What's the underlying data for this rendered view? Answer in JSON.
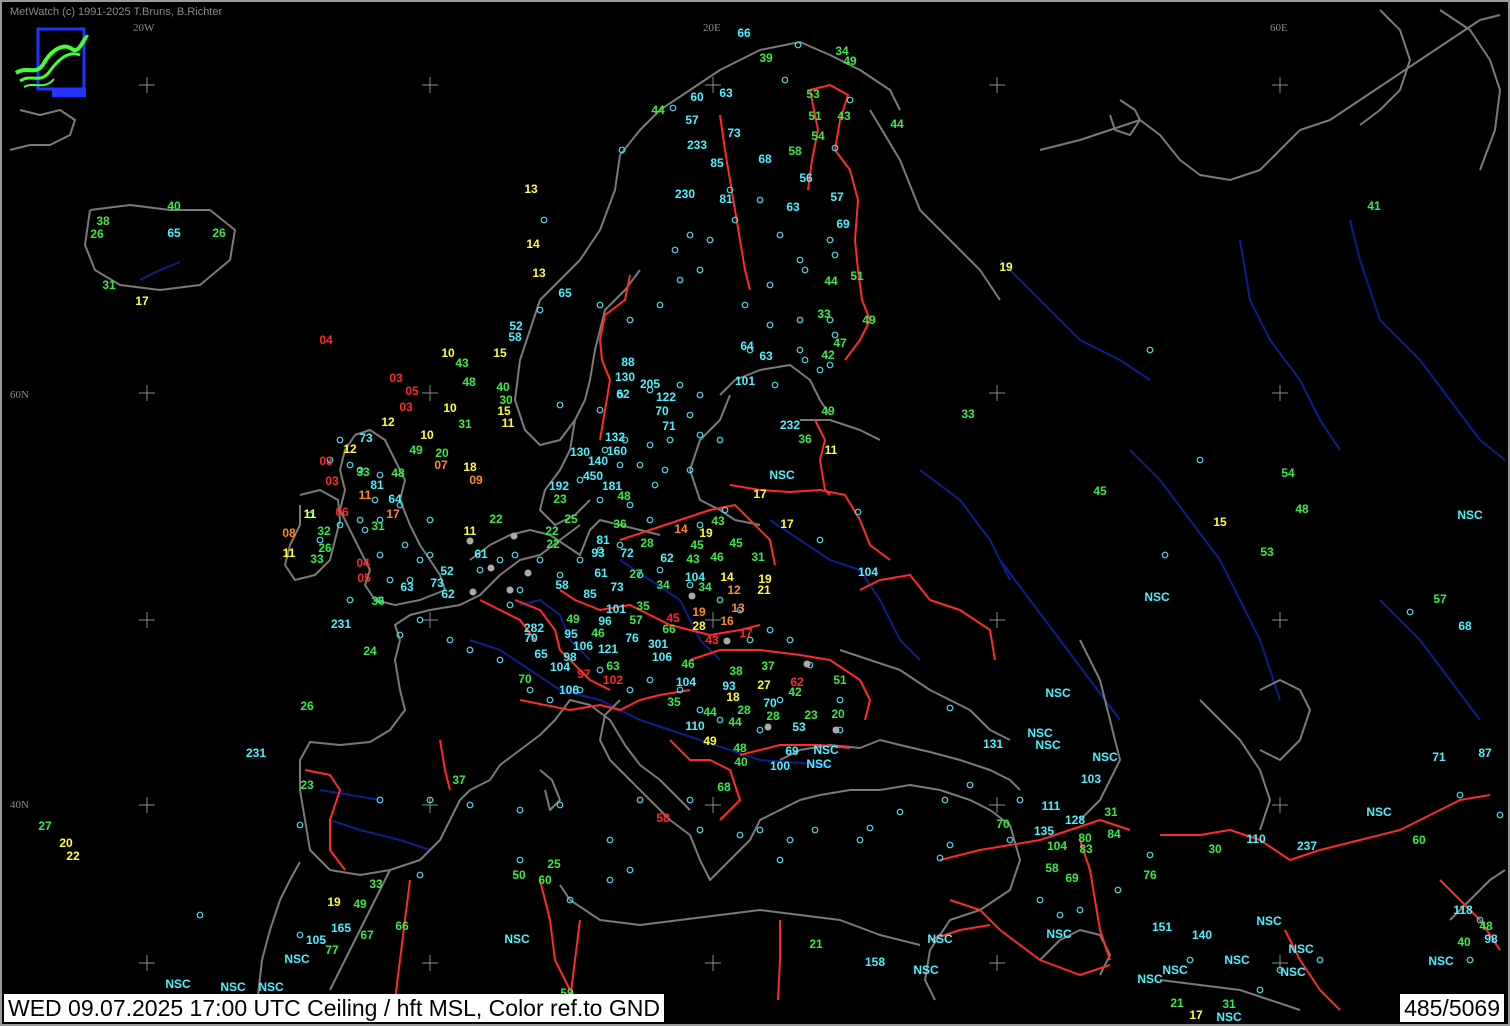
{
  "app": {
    "copyright": "MetWatch  (c) 1991-2025 T.Bruns, B.Richter",
    "status": "WED 09.07.2025 17:00 UTC    Ceiling / hft MSL, Color ref.to GND",
    "count": "485/5069"
  },
  "colors": {
    "background": "#000000",
    "coastline": "#7a7a7a",
    "borders": "#ff2a2a",
    "rivers": "#0d1f8c",
    "station": "#4ad8e8",
    "cyan": "#4ef2ff",
    "green": "#3ee84a",
    "yellow": "#ffff33",
    "orange": "#ff8a2a",
    "red": "#ff2a2a"
  },
  "grid_labels": [
    "20W",
    "20E",
    "60E",
    "60N",
    "40N"
  ],
  "observations": [
    {
      "text": "66",
      "c": "cyan"
    },
    {
      "text": "39",
      "c": "green"
    },
    {
      "text": "34",
      "c": "green"
    },
    {
      "text": "49",
      "c": "green"
    },
    {
      "text": "44",
      "c": "green"
    },
    {
      "text": "60",
      "c": "cyan"
    },
    {
      "text": "63",
      "c": "cyan"
    },
    {
      "text": "57",
      "c": "cyan"
    },
    {
      "text": "53",
      "c": "green"
    },
    {
      "text": "51",
      "c": "green"
    },
    {
      "text": "43",
      "c": "green"
    },
    {
      "text": "44",
      "c": "green"
    },
    {
      "text": "73",
      "c": "cyan"
    },
    {
      "text": "54",
      "c": "green"
    },
    {
      "text": "233",
      "c": "cyan"
    },
    {
      "text": "58",
      "c": "green"
    },
    {
      "text": "85",
      "c": "cyan"
    },
    {
      "text": "68",
      "c": "cyan"
    },
    {
      "text": "56",
      "c": "cyan"
    },
    {
      "text": "13",
      "c": "yellow"
    },
    {
      "text": "230",
      "c": "cyan"
    },
    {
      "text": "81",
      "c": "cyan"
    },
    {
      "text": "57",
      "c": "cyan"
    },
    {
      "text": "63",
      "c": "cyan"
    },
    {
      "text": "69",
      "c": "cyan"
    },
    {
      "text": "40",
      "c": "green"
    },
    {
      "text": "41",
      "c": "green"
    },
    {
      "text": "38",
      "c": "green"
    },
    {
      "text": "26",
      "c": "green"
    },
    {
      "text": "65",
      "c": "cyan"
    },
    {
      "text": "26",
      "c": "green"
    },
    {
      "text": "14",
      "c": "yellow"
    },
    {
      "text": "19",
      "c": "yellow"
    },
    {
      "text": "13",
      "c": "yellow"
    },
    {
      "text": "51",
      "c": "green"
    },
    {
      "text": "31",
      "c": "green"
    },
    {
      "text": "17",
      "c": "yellow"
    },
    {
      "text": "44",
      "c": "green"
    },
    {
      "text": "65",
      "c": "cyan"
    },
    {
      "text": "33",
      "c": "green"
    },
    {
      "text": "49",
      "c": "green"
    },
    {
      "text": "52",
      "c": "cyan"
    },
    {
      "text": "58",
      "c": "cyan"
    },
    {
      "text": "47",
      "c": "green"
    },
    {
      "text": "04",
      "c": "red"
    },
    {
      "text": "64",
      "c": "cyan"
    },
    {
      "text": "63",
      "c": "cyan"
    },
    {
      "text": "42",
      "c": "green"
    },
    {
      "text": "10",
      "c": "yellow"
    },
    {
      "text": "15",
      "c": "yellow"
    },
    {
      "text": "43",
      "c": "green"
    },
    {
      "text": "88",
      "c": "cyan"
    },
    {
      "text": "03",
      "c": "red"
    },
    {
      "text": "48",
      "c": "green"
    },
    {
      "text": "130",
      "c": "cyan"
    },
    {
      "text": "205",
      "c": "cyan"
    },
    {
      "text": "101",
      "c": "cyan"
    },
    {
      "text": "05",
      "c": "red"
    },
    {
      "text": "40",
      "c": "green"
    },
    {
      "text": "62",
      "c": "cyan"
    },
    {
      "text": "122",
      "c": "cyan"
    },
    {
      "text": "30",
      "c": "green"
    },
    {
      "text": "03",
      "c": "red"
    },
    {
      "text": "10",
      "c": "yellow"
    },
    {
      "text": "15",
      "c": "yellow"
    },
    {
      "text": "70",
      "c": "cyan"
    },
    {
      "text": "49",
      "c": "green"
    },
    {
      "text": "33",
      "c": "green"
    },
    {
      "text": "12",
      "c": "yellow"
    },
    {
      "text": "31",
      "c": "green"
    },
    {
      "text": "11",
      "c": "yellow"
    },
    {
      "text": "71",
      "c": "cyan"
    },
    {
      "text": "232",
      "c": "cyan"
    },
    {
      "text": "73",
      "c": "cyan"
    },
    {
      "text": "10",
      "c": "yellow"
    },
    {
      "text": "132",
      "c": "cyan"
    },
    {
      "text": "36",
      "c": "green"
    },
    {
      "text": "12",
      "c": "yellow"
    },
    {
      "text": "49",
      "c": "green"
    },
    {
      "text": "20",
      "c": "green"
    },
    {
      "text": "160",
      "c": "cyan"
    },
    {
      "text": "11",
      "c": "yellow"
    },
    {
      "text": "03",
      "c": "red"
    },
    {
      "text": "130",
      "c": "cyan"
    },
    {
      "text": "07",
      "c": "orange"
    },
    {
      "text": "140",
      "c": "cyan"
    },
    {
      "text": "18",
      "c": "yellow"
    },
    {
      "text": "33",
      "c": "green"
    },
    {
      "text": "48",
      "c": "green"
    },
    {
      "text": "450",
      "c": "cyan"
    },
    {
      "text": "NSC",
      "c": "cyan"
    },
    {
      "text": "03",
      "c": "red"
    },
    {
      "text": "09",
      "c": "orange"
    },
    {
      "text": "81",
      "c": "cyan"
    },
    {
      "text": "192",
      "c": "cyan"
    },
    {
      "text": "181",
      "c": "cyan"
    },
    {
      "text": "17",
      "c": "yellow"
    },
    {
      "text": "11",
      "c": "orange"
    },
    {
      "text": "64",
      "c": "cyan"
    },
    {
      "text": "23",
      "c": "green"
    },
    {
      "text": "48",
      "c": "green"
    },
    {
      "text": "54",
      "c": "green"
    },
    {
      "text": "45",
      "c": "green"
    },
    {
      "text": "11",
      "c": "yellow"
    },
    {
      "text": "06",
      "c": "red"
    },
    {
      "text": "17",
      "c": "orange"
    },
    {
      "text": "25",
      "c": "green"
    },
    {
      "text": "48",
      "c": "green"
    },
    {
      "text": "22",
      "c": "green"
    },
    {
      "text": "17",
      "c": "yellow"
    },
    {
      "text": "08",
      "c": "orange"
    },
    {
      "text": "31",
      "c": "green"
    },
    {
      "text": "11",
      "c": "yellow"
    },
    {
      "text": "36",
      "c": "green"
    },
    {
      "text": "15",
      "c": "yellow"
    },
    {
      "text": "43",
      "c": "green"
    },
    {
      "text": "32",
      "c": "green"
    },
    {
      "text": "22",
      "c": "green"
    },
    {
      "text": "14",
      "c": "orange"
    },
    {
      "text": "19",
      "c": "yellow"
    },
    {
      "text": "NSC",
      "c": "cyan"
    },
    {
      "text": "26",
      "c": "green"
    },
    {
      "text": "81",
      "c": "cyan"
    },
    {
      "text": "28",
      "c": "green"
    },
    {
      "text": "45",
      "c": "green"
    },
    {
      "text": "45",
      "c": "green"
    },
    {
      "text": "11",
      "c": "yellow"
    },
    {
      "text": "22",
      "c": "green"
    },
    {
      "text": "53",
      "c": "green"
    },
    {
      "text": "33",
      "c": "green"
    },
    {
      "text": "61",
      "c": "cyan"
    },
    {
      "text": "93",
      "c": "cyan"
    },
    {
      "text": "72",
      "c": "cyan"
    },
    {
      "text": "62",
      "c": "cyan"
    },
    {
      "text": "43",
      "c": "green"
    },
    {
      "text": "46",
      "c": "green"
    },
    {
      "text": "31",
      "c": "green"
    },
    {
      "text": "04",
      "c": "red"
    },
    {
      "text": "52",
      "c": "cyan"
    },
    {
      "text": "27",
      "c": "green"
    },
    {
      "text": "104",
      "c": "cyan"
    },
    {
      "text": "05",
      "c": "red"
    },
    {
      "text": "73",
      "c": "cyan"
    },
    {
      "text": "61",
      "c": "cyan"
    },
    {
      "text": "104",
      "c": "cyan"
    },
    {
      "text": "14",
      "c": "yellow"
    },
    {
      "text": "19",
      "c": "yellow"
    },
    {
      "text": "63",
      "c": "cyan"
    },
    {
      "text": "58",
      "c": "cyan"
    },
    {
      "text": "34",
      "c": "green"
    },
    {
      "text": "34",
      "c": "green"
    },
    {
      "text": "12",
      "c": "orange"
    },
    {
      "text": "21",
      "c": "yellow"
    },
    {
      "text": "62",
      "c": "cyan"
    },
    {
      "text": "85",
      "c": "cyan"
    },
    {
      "text": "73",
      "c": "cyan"
    },
    {
      "text": "NSC",
      "c": "cyan"
    },
    {
      "text": "57",
      "c": "green"
    },
    {
      "text": "36",
      "c": "green"
    },
    {
      "text": "101",
      "c": "cyan"
    },
    {
      "text": "35",
      "c": "green"
    },
    {
      "text": "19",
      "c": "orange"
    },
    {
      "text": "13",
      "c": "orange"
    },
    {
      "text": "231",
      "c": "cyan"
    },
    {
      "text": "49",
      "c": "green"
    },
    {
      "text": "96",
      "c": "cyan"
    },
    {
      "text": "57",
      "c": "green"
    },
    {
      "text": "45",
      "c": "red"
    },
    {
      "text": "16",
      "c": "orange"
    },
    {
      "text": "68",
      "c": "cyan"
    },
    {
      "text": "282",
      "c": "cyan"
    },
    {
      "text": "66",
      "c": "green"
    },
    {
      "text": "28",
      "c": "yellow"
    },
    {
      "text": "17",
      "c": "red"
    },
    {
      "text": "70",
      "c": "cyan"
    },
    {
      "text": "95",
      "c": "cyan"
    },
    {
      "text": "46",
      "c": "green"
    },
    {
      "text": "76",
      "c": "cyan"
    },
    {
      "text": "43",
      "c": "red"
    },
    {
      "text": "24",
      "c": "green"
    },
    {
      "text": "106",
      "c": "cyan"
    },
    {
      "text": "121",
      "c": "cyan"
    },
    {
      "text": "301",
      "c": "cyan"
    },
    {
      "text": "65",
      "c": "cyan"
    },
    {
      "text": "98",
      "c": "cyan"
    },
    {
      "text": "106",
      "c": "cyan"
    },
    {
      "text": "104",
      "c": "cyan"
    },
    {
      "text": "97",
      "c": "red"
    },
    {
      "text": "63",
      "c": "green"
    },
    {
      "text": "46",
      "c": "green"
    },
    {
      "text": "38",
      "c": "green"
    },
    {
      "text": "37",
      "c": "green"
    },
    {
      "text": "NSC",
      "c": "cyan"
    },
    {
      "text": "70",
      "c": "green"
    },
    {
      "text": "102",
      "c": "red"
    },
    {
      "text": "104",
      "c": "cyan"
    },
    {
      "text": "62",
      "c": "red"
    },
    {
      "text": "51",
      "c": "green"
    },
    {
      "text": "106",
      "c": "cyan"
    },
    {
      "text": "93",
      "c": "cyan"
    },
    {
      "text": "27",
      "c": "yellow"
    },
    {
      "text": "42",
      "c": "green"
    },
    {
      "text": "35",
      "c": "green"
    },
    {
      "text": "18",
      "c": "yellow"
    },
    {
      "text": "70",
      "c": "cyan"
    },
    {
      "text": "26",
      "c": "green"
    },
    {
      "text": "44",
      "c": "green"
    },
    {
      "text": "28",
      "c": "green"
    },
    {
      "text": "23",
      "c": "green"
    },
    {
      "text": "20",
      "c": "green"
    },
    {
      "text": "28",
      "c": "green"
    },
    {
      "text": "110",
      "c": "cyan"
    },
    {
      "text": "44",
      "c": "green"
    },
    {
      "text": "53",
      "c": "cyan"
    },
    {
      "text": "NSC",
      "c": "cyan"
    },
    {
      "text": "131",
      "c": "cyan"
    },
    {
      "text": "NSC",
      "c": "cyan"
    },
    {
      "text": "49",
      "c": "yellow"
    },
    {
      "text": "48",
      "c": "green"
    },
    {
      "text": "69",
      "c": "cyan"
    },
    {
      "text": "NSC",
      "c": "cyan"
    },
    {
      "text": "NSC",
      "c": "cyan"
    },
    {
      "text": "231",
      "c": "cyan"
    },
    {
      "text": "40",
      "c": "green"
    },
    {
      "text": "100",
      "c": "cyan"
    },
    {
      "text": "NSC",
      "c": "cyan"
    },
    {
      "text": "71",
      "c": "cyan"
    },
    {
      "text": "87",
      "c": "cyan"
    },
    {
      "text": "37",
      "c": "green"
    },
    {
      "text": "23",
      "c": "green"
    },
    {
      "text": "68",
      "c": "green"
    },
    {
      "text": "103",
      "c": "cyan"
    },
    {
      "text": "111",
      "c": "cyan"
    },
    {
      "text": "31",
      "c": "green"
    },
    {
      "text": "NSC",
      "c": "cyan"
    },
    {
      "text": "128",
      "c": "cyan"
    },
    {
      "text": "27",
      "c": "green"
    },
    {
      "text": "58",
      "c": "red"
    },
    {
      "text": "70",
      "c": "green"
    },
    {
      "text": "135",
      "c": "cyan"
    },
    {
      "text": "84",
      "c": "green"
    },
    {
      "text": "80",
      "c": "green"
    },
    {
      "text": "110",
      "c": "cyan"
    },
    {
      "text": "60",
      "c": "green"
    },
    {
      "text": "20",
      "c": "yellow"
    },
    {
      "text": "104",
      "c": "green"
    },
    {
      "text": "83",
      "c": "green"
    },
    {
      "text": "30",
      "c": "green"
    },
    {
      "text": "237",
      "c": "cyan"
    },
    {
      "text": "22",
      "c": "yellow"
    },
    {
      "text": "25",
      "c": "green"
    },
    {
      "text": "58",
      "c": "green"
    },
    {
      "text": "50",
      "c": "green"
    },
    {
      "text": "60",
      "c": "green"
    },
    {
      "text": "69",
      "c": "green"
    },
    {
      "text": "76",
      "c": "green"
    },
    {
      "text": "33",
      "c": "green"
    },
    {
      "text": "19",
      "c": "yellow"
    },
    {
      "text": "49",
      "c": "green"
    },
    {
      "text": "66",
      "c": "green"
    },
    {
      "text": "165",
      "c": "cyan"
    },
    {
      "text": "118",
      "c": "cyan"
    },
    {
      "text": "48",
      "c": "green"
    },
    {
      "text": "NSC",
      "c": "cyan"
    },
    {
      "text": "151",
      "c": "cyan"
    },
    {
      "text": "105",
      "c": "cyan"
    },
    {
      "text": "67",
      "c": "green"
    },
    {
      "text": "NSC",
      "c": "cyan"
    },
    {
      "text": "140",
      "c": "cyan"
    },
    {
      "text": "40",
      "c": "green"
    },
    {
      "text": "98",
      "c": "cyan"
    },
    {
      "text": "77",
      "c": "green"
    },
    {
      "text": "NSC",
      "c": "cyan"
    },
    {
      "text": "21",
      "c": "green"
    },
    {
      "text": "NSC",
      "c": "cyan"
    },
    {
      "text": "NSC",
      "c": "cyan"
    },
    {
      "text": "NSC",
      "c": "cyan"
    },
    {
      "text": "NSC",
      "c": "cyan"
    },
    {
      "text": "158",
      "c": "cyan"
    },
    {
      "text": "NSC",
      "c": "cyan"
    },
    {
      "text": "NSC",
      "c": "cyan"
    },
    {
      "text": "NSC",
      "c": "cyan"
    },
    {
      "text": "NSC",
      "c": "cyan"
    },
    {
      "text": "NSC",
      "c": "cyan"
    },
    {
      "text": "21",
      "c": "green"
    },
    {
      "text": "31",
      "c": "green"
    },
    {
      "text": "17",
      "c": "yellow"
    },
    {
      "text": "NSC",
      "c": "cyan"
    },
    {
      "text": "NSC",
      "c": "cyan"
    },
    {
      "text": "NSC",
      "c": "cyan"
    },
    {
      "text": "NSC",
      "c": "cyan"
    },
    {
      "text": "59",
      "c": "green"
    }
  ]
}
